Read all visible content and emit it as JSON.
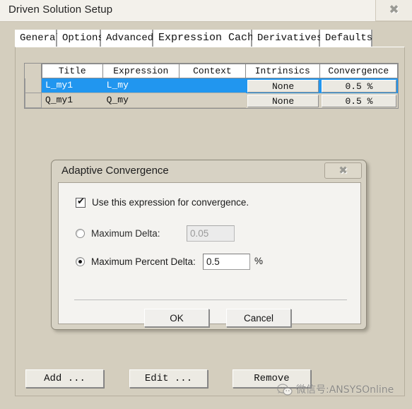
{
  "window": {
    "title": "Driven Solution Setup",
    "close_glyph": "✖"
  },
  "tabs": [
    {
      "label": "General",
      "selected": false
    },
    {
      "label": "Options",
      "selected": false
    },
    {
      "label": "Advanced",
      "selected": false
    },
    {
      "label": "Expression Cache",
      "selected": true
    },
    {
      "label": "Derivatives",
      "selected": false
    },
    {
      "label": "Defaults",
      "selected": false
    }
  ],
  "table": {
    "columns": [
      "Title",
      "Expression",
      "Context",
      "Intrinsics",
      "Convergence"
    ],
    "rows": [
      {
        "title": "L_my1",
        "expression": "L_my",
        "context": "",
        "intrinsics": "None",
        "convergence": "0.5 %",
        "selected": true
      },
      {
        "title": "Q_my1",
        "expression": "Q_my",
        "context": "",
        "intrinsics": "None",
        "convergence": "0.5 %",
        "selected": false
      }
    ]
  },
  "bottom_buttons": [
    {
      "label": "Add ..."
    },
    {
      "label": "Edit ..."
    },
    {
      "label": "Remove"
    }
  ],
  "watermark": {
    "text": "微信号:ANSYSOnline"
  },
  "dialog": {
    "title": "Adaptive Convergence",
    "close_glyph": "✖",
    "checkbox": {
      "label": "Use this expression for convergence.",
      "checked": true,
      "tick": "✔"
    },
    "max_delta": {
      "label": "Maximum Delta:",
      "value": "0.05",
      "selected": false,
      "enabled": false
    },
    "max_percent_delta": {
      "label": "Maximum Percent Delta:",
      "value": "0.5",
      "unit": "%",
      "selected": true,
      "enabled": true
    },
    "ok_label": "OK",
    "cancel_label": "Cancel"
  },
  "colors": {
    "selection_blue": "#2196ef",
    "window_background": "#d4cebe",
    "dialog_background": "#f4f3f0"
  }
}
